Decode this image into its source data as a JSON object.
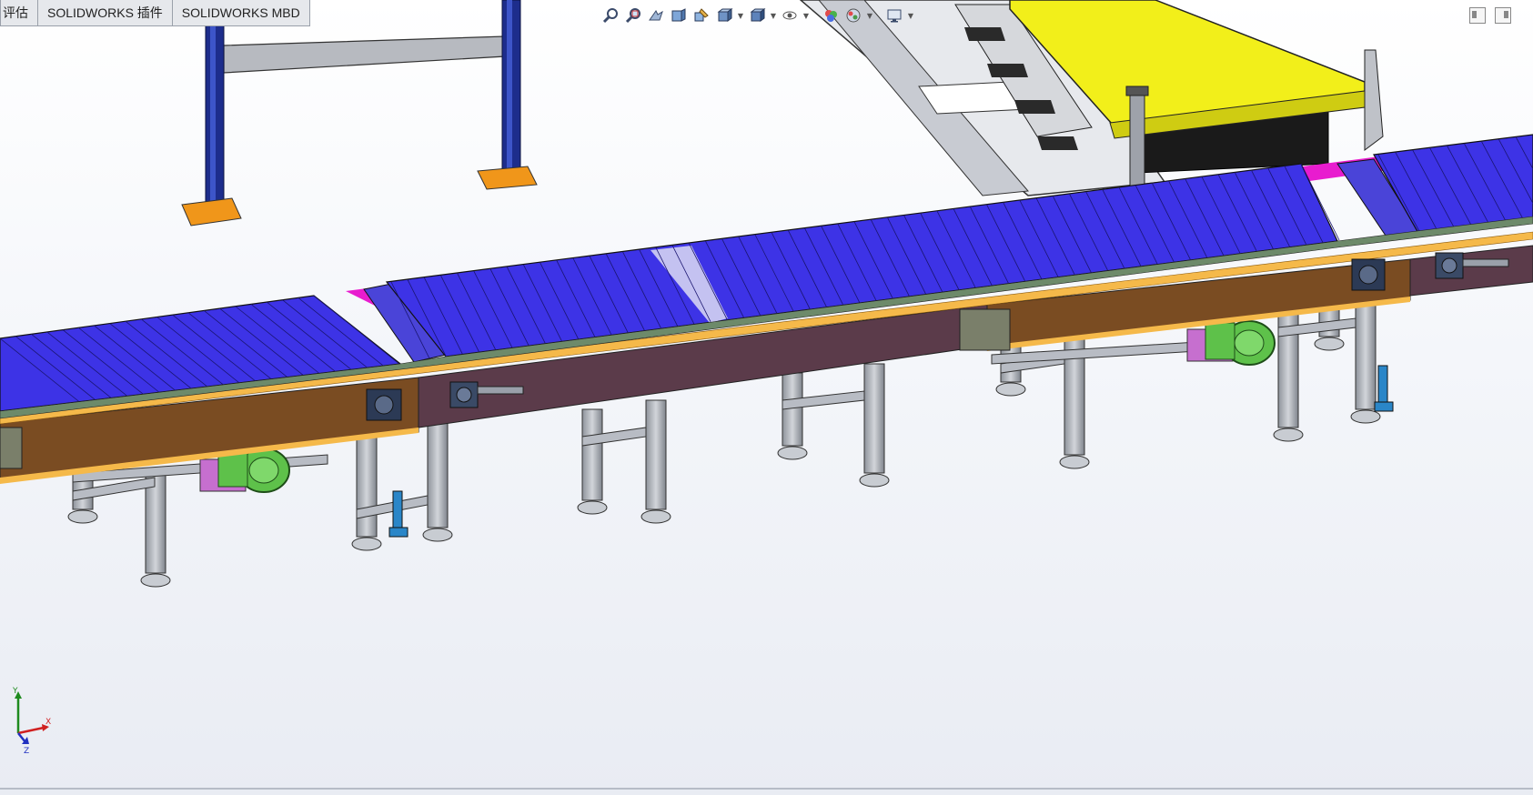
{
  "command_tabs": [
    {
      "label": "评估",
      "cut": true
    },
    {
      "label": "SOLIDWORKS 插件",
      "cut": false
    },
    {
      "label": "SOLIDWORKS MBD",
      "cut": false
    }
  ],
  "hud_icons": [
    "zoom-to-fit-icon",
    "zoom-to-area-icon",
    "previous-view-icon",
    "section-view-icon",
    "dynamic-annotation-icon",
    "view-orientation-icon",
    "display-style-icon",
    "hide-show-items-icon",
    "edit-appearance-icon",
    "apply-scene-icon",
    "view-settings-icon"
  ],
  "triad_labels": {
    "x": "X",
    "y": "Y",
    "z": "Z"
  },
  "colors": {
    "belt": "#3d33e6",
    "belt_dark": "#2a22b8",
    "frame_orange": "#f5b94a",
    "frame_brown": "#7a4c22",
    "frame_mauve": "#5b3b4a",
    "magenta": "#e81ccf",
    "column_blue": "#1d2d8c",
    "yellow_cover": "#f2ef1a",
    "steel": "#b8bcc4",
    "motor_green": "#5ec14a",
    "foot_pad": "#f0961a"
  }
}
